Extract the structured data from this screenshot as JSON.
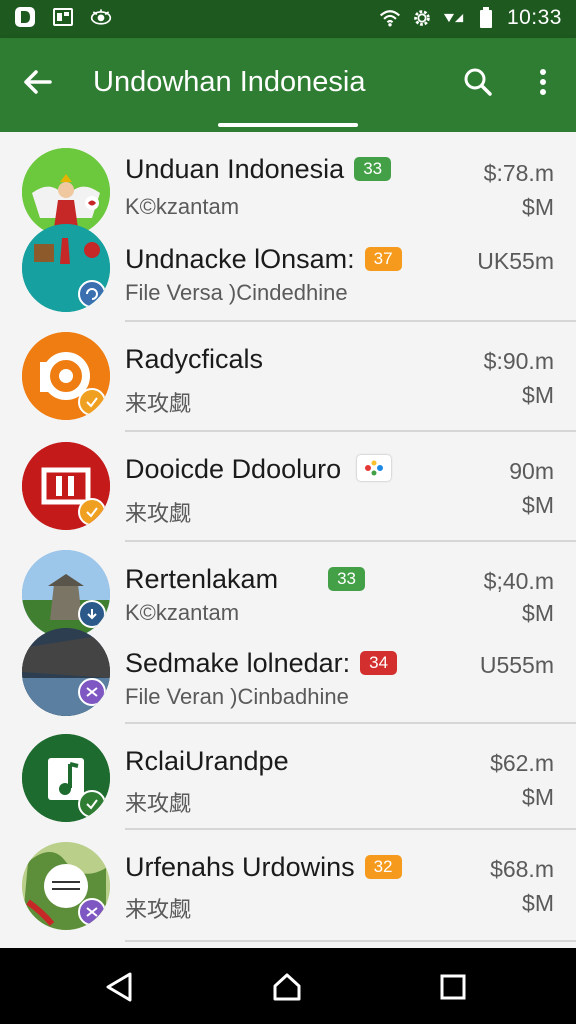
{
  "status_bar": {
    "time": "10:33",
    "left_icons": [
      "d-app-icon",
      "photo-icon",
      "eye-icon"
    ],
    "right_icons": [
      "wifi-icon",
      "settings-icon",
      "signal-icon",
      "battery-icon"
    ]
  },
  "app_bar": {
    "title": "Undowhan Indonesia",
    "color": "#2e7d32"
  },
  "items": [
    {
      "name": "Unduan Indonesia",
      "badge": "33",
      "badge_color": "#43a047",
      "sub": "K©kzantam",
      "right1": "$:78.m",
      "right2": "$M"
    },
    {
      "name": "Undnacke lOnsam:",
      "badge": "37",
      "badge_color": "#f59a1c",
      "sub": "File Versa )Cindedhine",
      "right1": "UK55m",
      "right2": ""
    },
    {
      "name": "Radycficals",
      "badge": "",
      "badge_color": "",
      "sub": "来攻觑",
      "right1": "$:90.m",
      "right2": "$M"
    },
    {
      "name": "Dooicde Ddooluro",
      "badge": "",
      "badge_color": "",
      "sub": "来攻觑",
      "right1": "90m",
      "right2": "$M"
    },
    {
      "name": "Rertenlakam",
      "badge": "33",
      "badge_color": "#43a047",
      "sub": "K©kzantam",
      "right1": "$;40.m",
      "right2": "$M"
    },
    {
      "name": "Sedmake lolnedar:",
      "badge": "34",
      "badge_color": "#d32f2f",
      "sub": "File Veran )Cinbadhine",
      "right1": "U555m",
      "right2": ""
    },
    {
      "name": "RclaiUrandpe",
      "badge": "",
      "badge_color": "",
      "sub": "来攻觑",
      "right1": "$62.m",
      "right2": "$M"
    },
    {
      "name": "Urfenahs Urdowins",
      "badge": "32",
      "badge_color": "#f59a1c",
      "sub": "来攻觑",
      "right1": "$68.m",
      "right2": "$M"
    }
  ],
  "nav": {
    "icons": [
      "back-triangle-icon",
      "home-icon",
      "recents-icon"
    ]
  }
}
